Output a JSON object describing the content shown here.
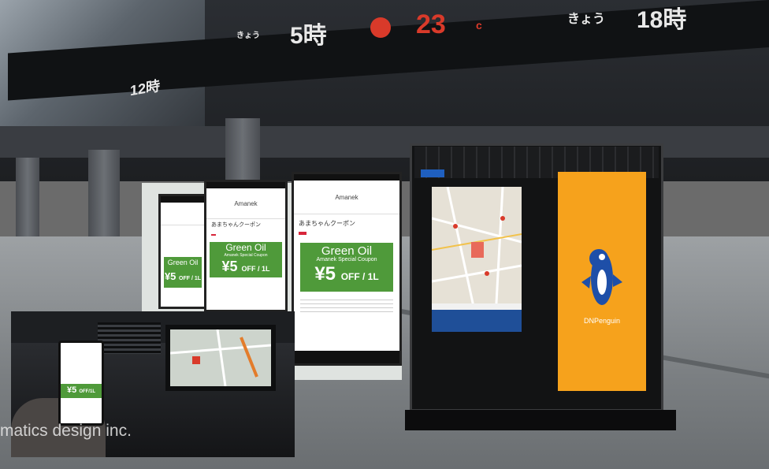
{
  "scene": {
    "ticker_texts": [
      "5時",
      "23",
      "c",
      "きょう",
      "18時",
      "12時",
      "きょう"
    ],
    "watermark": "matics design inc.",
    "kiosk_logo": "DNPenguin"
  },
  "phone_small": {
    "coupon_title": "Green Oil",
    "coupon_price": "¥5",
    "coupon_suffix": "OFF / 1L"
  },
  "phone_mid": {
    "header": "Amanek",
    "label": "あまちゃんクーポン",
    "coupon_title": "Green Oil",
    "coupon_sub": "Amanek Special Coupon",
    "coupon_price": "¥5",
    "coupon_suffix": "OFF / 1L"
  },
  "phone_large": {
    "header": "Amanek",
    "label": "あまちゃんクーポン",
    "coupon_title": "Green Oil",
    "coupon_sub": "Amanek Special Coupon",
    "coupon_price": "¥5",
    "coupon_suffix": "OFF / 1L"
  },
  "hand_phone": {
    "coupon_price": "¥5",
    "coupon_suffix": "OFF/1L"
  },
  "colors": {
    "coupon_green": "#4f9a3a",
    "kiosk_orange": "#f6a21c",
    "ticker_red": "#d93a2a",
    "penguin_blue": "#1e4fa8"
  }
}
